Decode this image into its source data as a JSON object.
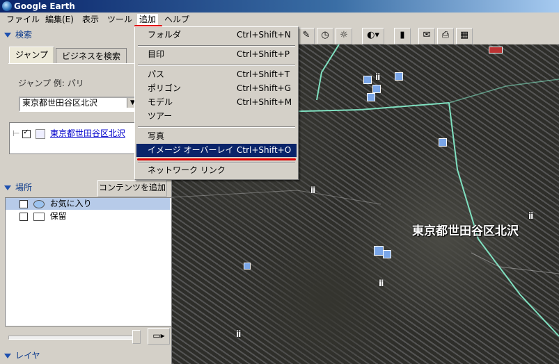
{
  "window": {
    "title": "Google Earth"
  },
  "menubar": [
    "ファイル",
    "編集(E)",
    "表示",
    "ツール",
    "追加",
    "ヘルプ"
  ],
  "add_menu": {
    "items": [
      {
        "label": "フォルダ",
        "shortcut": "Ctrl+Shift+N"
      },
      {
        "label": "目印",
        "shortcut": "Ctrl+Shift+P"
      },
      {
        "label": "パス",
        "shortcut": "Ctrl+Shift+T"
      },
      {
        "label": "ポリゴン",
        "shortcut": "Ctrl+Shift+G"
      },
      {
        "label": "モデル",
        "shortcut": "Ctrl+Shift+M"
      },
      {
        "label": "ツアー",
        "shortcut": ""
      },
      {
        "label": "写真",
        "shortcut": ""
      },
      {
        "label": "イメージ オーバーレイ",
        "shortcut": "Ctrl+Shift+O"
      },
      {
        "label": "ネットワーク リンク",
        "shortcut": ""
      }
    ]
  },
  "search": {
    "header": "検索",
    "tabs": [
      "ジャンプ",
      "ビジネスを検索"
    ],
    "jump_hint": "ジャンプ 例: パリ",
    "query": "東京都世田谷区北沢",
    "result": "東京都世田谷区北沢"
  },
  "places": {
    "header": "場所",
    "add_content_button": "コンテンツを追加",
    "items": [
      "お気に入り",
      "保留"
    ]
  },
  "layers": {
    "header": "レイヤ"
  },
  "map": {
    "label": "東京都世田谷区北沢"
  },
  "colors": {
    "highlight": "#0a246a",
    "annotation_red": "#e00000"
  }
}
